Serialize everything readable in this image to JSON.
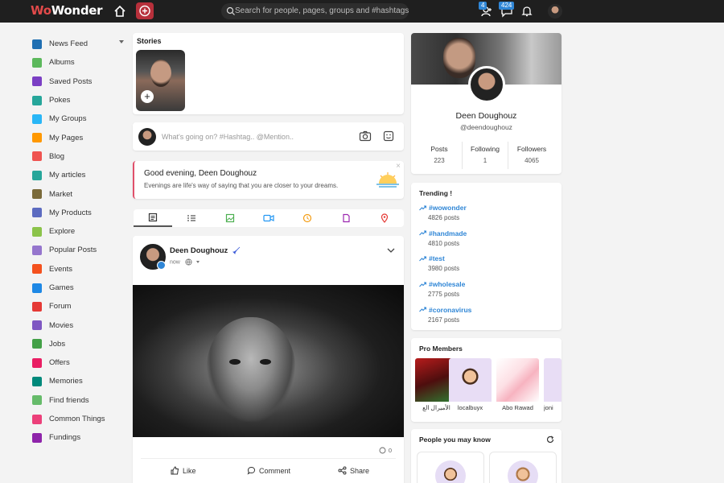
{
  "topbar": {
    "logo_part1": "Wo",
    "logo_part2": "Wonder",
    "search_placeholder": "Search for people, pages, groups and #hashtags",
    "friend_requests_count": "4",
    "messages_count": "424"
  },
  "sidebar": {
    "items": [
      {
        "label": "News Feed",
        "icon": "home-icon",
        "color": "#1f6fb2"
      },
      {
        "label": "Albums",
        "icon": "image-icon",
        "color": "#5cb85c"
      },
      {
        "label": "Saved Posts",
        "icon": "bookmark-icon",
        "color": "#7b3fc4"
      },
      {
        "label": "Pokes",
        "icon": "thumbs-icon",
        "color": "#26a69a"
      },
      {
        "label": "My Groups",
        "icon": "groups-icon",
        "color": "#29b6f6"
      },
      {
        "label": "My Pages",
        "icon": "flag-icon",
        "color": "#ff9800"
      },
      {
        "label": "Blog",
        "icon": "blog-icon",
        "color": "#ef5350"
      },
      {
        "label": "My articles",
        "icon": "article-icon",
        "color": "#26a69a"
      },
      {
        "label": "Market",
        "icon": "market-icon",
        "color": "#7a6a3a"
      },
      {
        "label": "My Products",
        "icon": "bag-icon",
        "color": "#5c6bc0"
      },
      {
        "label": "Explore",
        "icon": "compass-icon",
        "color": "#8bc34a"
      },
      {
        "label": "Popular Posts",
        "icon": "popular-icon",
        "color": "#9575cd"
      },
      {
        "label": "Events",
        "icon": "calendar-icon",
        "color": "#f4511e"
      },
      {
        "label": "Games",
        "icon": "gamepad-icon",
        "color": "#1e88e5"
      },
      {
        "label": "Forum",
        "icon": "forum-icon",
        "color": "#e53935"
      },
      {
        "label": "Movies",
        "icon": "film-icon",
        "color": "#7e57c2"
      },
      {
        "label": "Jobs",
        "icon": "briefcase-icon",
        "color": "#43a047"
      },
      {
        "label": "Offers",
        "icon": "tag-icon",
        "color": "#e91e63"
      },
      {
        "label": "Memories",
        "icon": "history-icon",
        "color": "#00897b"
      },
      {
        "label": "Find friends",
        "icon": "find-friends-icon",
        "color": "#66bb6a"
      },
      {
        "label": "Common Things",
        "icon": "common-icon",
        "color": "#ec407a"
      },
      {
        "label": "Fundings",
        "icon": "heart-icon",
        "color": "#8e24aa"
      }
    ]
  },
  "stories": {
    "title": "Stories"
  },
  "composer": {
    "placeholder": "What's going on? #Hashtag.. @Mention.."
  },
  "greeting": {
    "title": "Good evening, Deen Doughouz",
    "subtitle": "Evenings are life's way of saying that you are closer to your dreams."
  },
  "post": {
    "author": "Deen Doughouz",
    "time": "now",
    "comments_count": "0",
    "like_label": "Like",
    "comment_label": "Comment",
    "share_label": "Share"
  },
  "profile": {
    "name": "Deen Doughouz",
    "handle": "@deendoughouz",
    "stats": [
      {
        "label": "Posts",
        "value": "223"
      },
      {
        "label": "Following",
        "value": "1"
      },
      {
        "label": "Followers",
        "value": "4065"
      }
    ]
  },
  "trending": {
    "title": "Trending !",
    "items": [
      {
        "tag": "#wowonder",
        "count": "4826 posts"
      },
      {
        "tag": "#handmade",
        "count": "4810 posts"
      },
      {
        "tag": "#test",
        "count": "3980 posts"
      },
      {
        "tag": "#wholesale",
        "count": "2775 posts"
      },
      {
        "tag": "#coronavirus",
        "count": "2167 posts"
      }
    ]
  },
  "pro_members": {
    "title": "Pro Members",
    "members": [
      {
        "name": "الأميرال الع"
      },
      {
        "name": "localbuyx"
      },
      {
        "name": "Abo Rawad"
      },
      {
        "name": "joni"
      }
    ]
  },
  "people": {
    "title": "People you may know"
  }
}
